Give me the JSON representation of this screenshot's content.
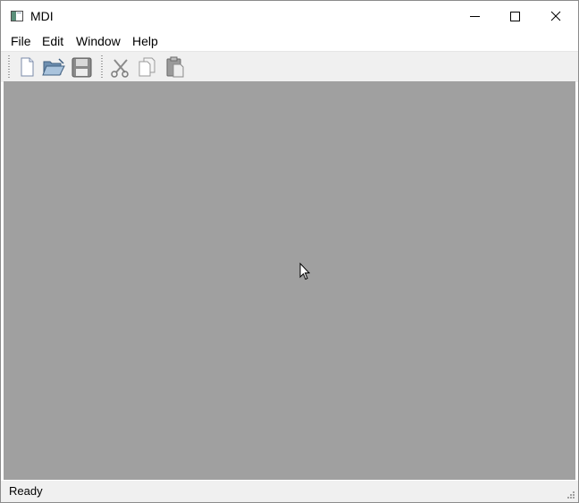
{
  "window": {
    "title": "MDI"
  },
  "menu": {
    "items": [
      "File",
      "Edit",
      "Window",
      "Help"
    ]
  },
  "toolbar": {
    "groups": [
      [
        "new-document-icon",
        "open-folder-icon",
        "save-floppy-icon"
      ],
      [
        "cut-scissors-icon",
        "copy-pages-icon",
        "paste-clipboard-icon"
      ]
    ]
  },
  "statusbar": {
    "text": "Ready"
  },
  "colors": {
    "workspace": "#a0a0a0",
    "toolbar": "#f0f0f0",
    "statusbar": "#f0f0f0"
  }
}
